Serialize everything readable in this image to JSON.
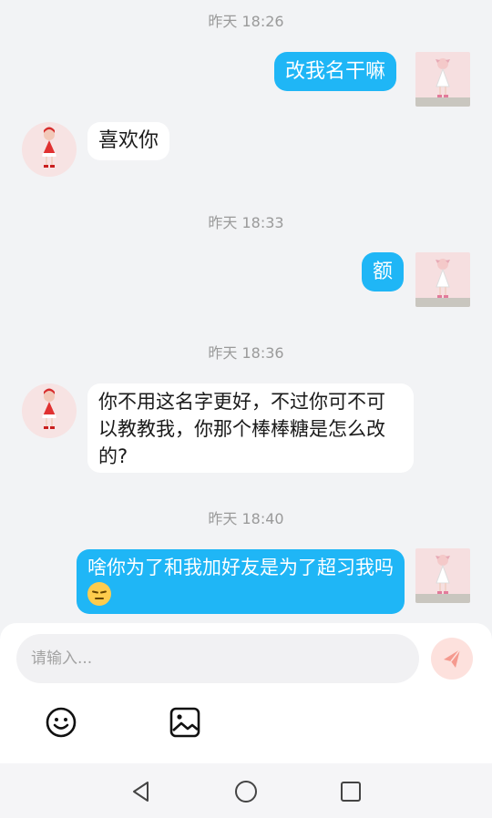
{
  "messages": [
    {
      "timestamp": "昨天 18:26"
    },
    {
      "sender": "me",
      "text": "改我名干嘛"
    },
    {
      "sender": "them",
      "text": "喜欢你"
    },
    {
      "timestamp": "昨天 18:33"
    },
    {
      "sender": "me",
      "text": "额"
    },
    {
      "timestamp": "昨天 18:36"
    },
    {
      "sender": "them",
      "text": "你不用这名字更好，不过你可不可以教教我，你那个棒棒糖是怎么改的?"
    },
    {
      "timestamp": "昨天 18:40"
    },
    {
      "sender": "me",
      "text": "啥你为了和我加好友是为了超习我吗",
      "emoji": "pensive-face"
    }
  ],
  "composer": {
    "placeholder": "请输入..."
  },
  "icons": {
    "send": "send-icon",
    "emoji": "smiley-icon",
    "image": "image-icon",
    "nav_back": "back-triangle-icon",
    "nav_home": "home-circle-icon",
    "nav_recent": "recent-square-icon"
  },
  "colors": {
    "my_bubble": "#1fb6f6",
    "their_bubble": "#ffffff",
    "background": "#f2f3f5",
    "send_button": "#fde1dd",
    "send_arrow": "#f59a8f"
  }
}
